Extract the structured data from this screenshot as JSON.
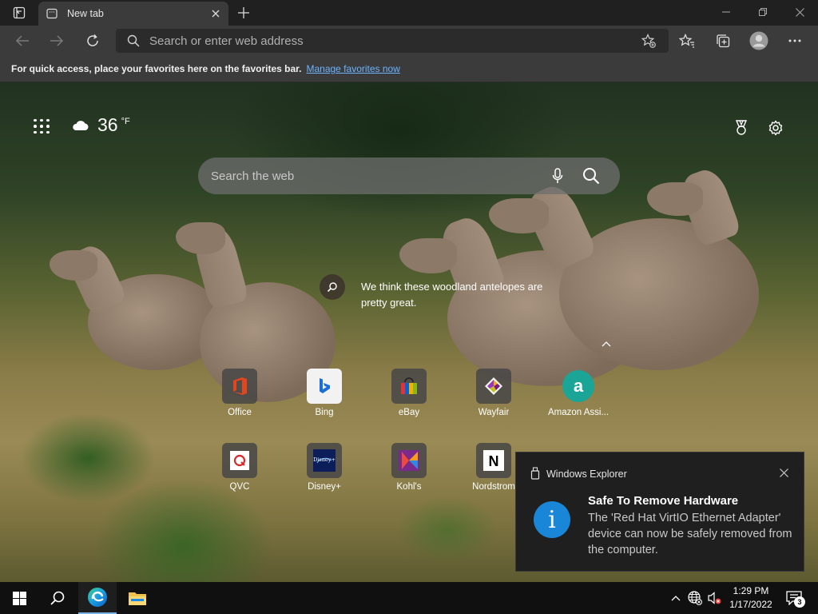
{
  "browser": {
    "tab_title": "New tab",
    "address_placeholder": "Search or enter web address",
    "favorites_bar_text": "For quick access, place your favorites here on the favorites bar.",
    "favorites_link": "Manage favorites now"
  },
  "ntp": {
    "weather_temp": "36",
    "weather_unit": "°F",
    "search_placeholder": "Search the web",
    "image_caption": "We think these woodland antelopes are pretty great.",
    "quick_links": [
      {
        "label": "Office",
        "icon": "office-icon",
        "color": "#e3451d"
      },
      {
        "label": "Bing",
        "icon": "bing-icon",
        "color": "#1a6fd8"
      },
      {
        "label": "eBay",
        "icon": "ebay-icon",
        "color": "#e53238"
      },
      {
        "label": "Wayfair",
        "icon": "wayfair-icon",
        "color": "#7f187f"
      },
      {
        "label": "Amazon Assi...",
        "icon": "amazon-assistant-icon",
        "color": "#1aa597"
      },
      {
        "label": "QVC",
        "icon": "qvc-icon",
        "color": "#d62b2b"
      },
      {
        "label": "Disney+",
        "icon": "disney-plus-icon",
        "color": "#0b1e5a"
      },
      {
        "label": "Kohl's",
        "icon": "kohls-icon",
        "color": "#7a2a8a"
      },
      {
        "label": "Nordstrom",
        "icon": "nordstrom-icon",
        "color": "#000000"
      }
    ]
  },
  "toast": {
    "app_name": "Windows Explorer",
    "title": "Safe To Remove Hardware",
    "body": "The 'Red Hat VirtIO Ethernet Adapter' device can now be safely removed from the computer.",
    "info_glyph": "i"
  },
  "taskbar": {
    "time": "1:29 PM",
    "date": "1/17/2022",
    "notification_count": "3"
  }
}
